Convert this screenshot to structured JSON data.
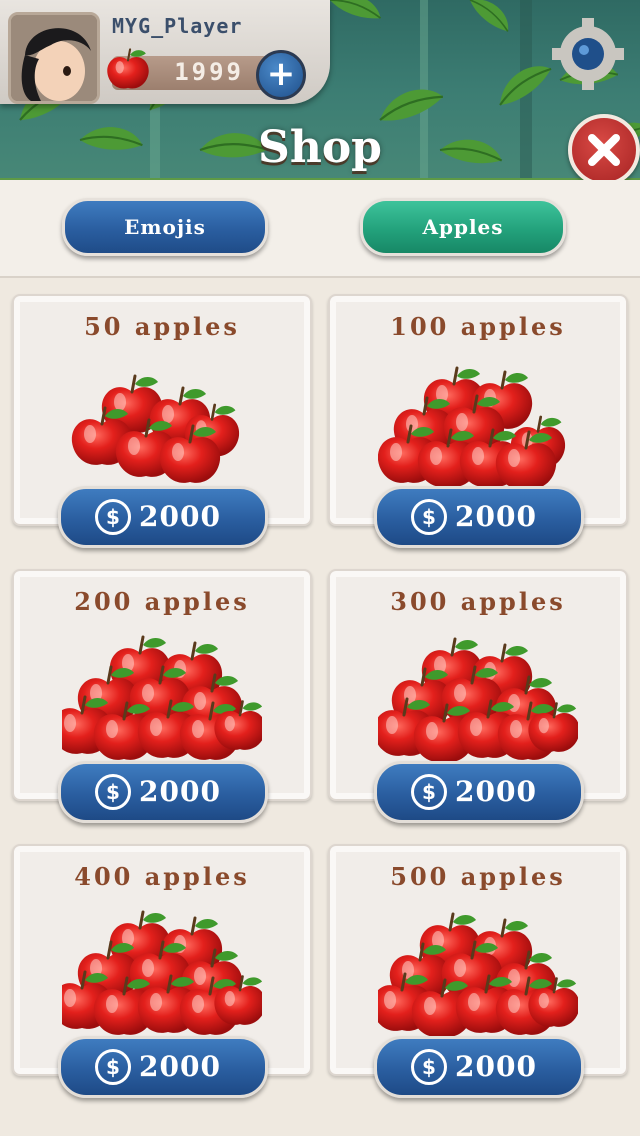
{
  "player": {
    "name": "MYG_Player",
    "apples": "1999"
  },
  "header": {
    "title": "Shop"
  },
  "tabs": [
    {
      "label": "Emojis",
      "active": false
    },
    {
      "label": "Apples",
      "active": true
    }
  ],
  "items": [
    {
      "title": "50  apples",
      "price": "2000"
    },
    {
      "title": "100  apples",
      "price": "2000"
    },
    {
      "title": "200  apples",
      "price": "2000"
    },
    {
      "title": "300  apples",
      "price": "2000"
    },
    {
      "title": "400  apples",
      "price": "2000"
    },
    {
      "title": "500  apples",
      "price": "2000"
    }
  ],
  "coin_symbol": "$",
  "colors": {
    "tab_blue": "#2a5ea0",
    "tab_green": "#23a27c",
    "close_red": "#c0302c",
    "title_brown": "#8a4a2c"
  }
}
